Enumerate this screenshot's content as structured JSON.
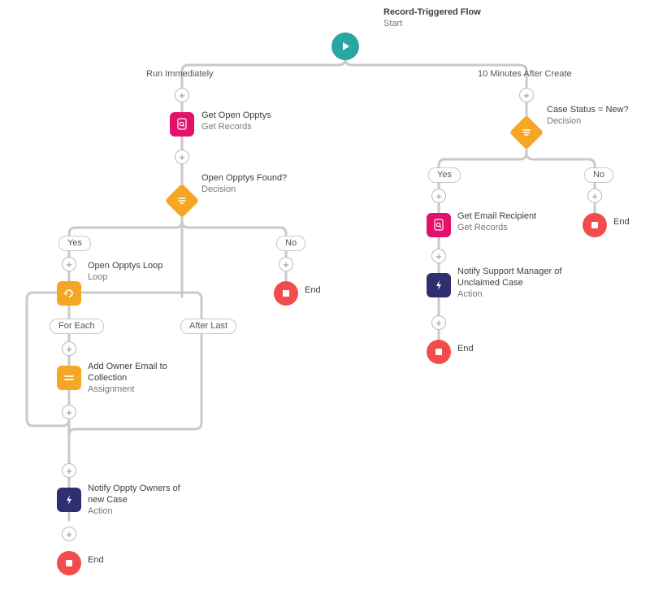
{
  "header": {
    "title": "Record-Triggered Flow",
    "subtitle": "Start"
  },
  "paths": {
    "run_immediately": "Run Immediately",
    "ten_min": "10 Minutes After Create"
  },
  "branch_labels": {
    "yes": "Yes",
    "no": "No",
    "foreach": "For Each",
    "afterlast": "After Last"
  },
  "left": {
    "get_opptys": {
      "title": "Get Open Opptys",
      "subtitle": "Get Records"
    },
    "decision": {
      "title": "Open Opptys Found?",
      "subtitle": "Decision"
    },
    "loop": {
      "title": "Open Opptys Loop",
      "subtitle": "Loop"
    },
    "assign": {
      "title": "Add Owner Email to Collection",
      "subtitle": "Assignment"
    },
    "notify": {
      "title": "Notify Oppty Owners of new Case",
      "subtitle": "Action"
    },
    "end_no": "End",
    "end_main": "End"
  },
  "right": {
    "decision": {
      "title": "Case Status = New?",
      "subtitle": "Decision"
    },
    "get_rcpt": {
      "title": "Get Email Recipient",
      "subtitle": "Get Records"
    },
    "notify": {
      "title": "Notify Support Manager of Unclaimed Case",
      "subtitle": "Action"
    },
    "end_yes": "End",
    "end_no": "End"
  }
}
